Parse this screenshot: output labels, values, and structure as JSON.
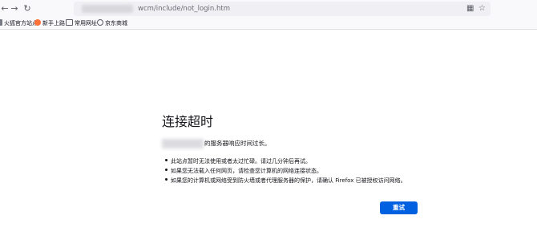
{
  "browser": {
    "url_path": "wcm/include/not_login.htm",
    "icons": {
      "back": "back-arrow-icon",
      "forward": "forward-arrow-icon",
      "reload": "reload-icon",
      "qr": "qr-code-icon",
      "bookmark": "star-icon"
    },
    "bookmarks": [
      {
        "label": "火狐官方站点"
      },
      {
        "label": "新手上路"
      },
      {
        "label": "常用网址"
      },
      {
        "label": "京东商城"
      }
    ]
  },
  "error_page": {
    "title": "连接超时",
    "description": "的服务器响应时间过长。",
    "bullets": [
      "此站点暂时无法使用或者太过忙碌。请过几分钟后再试。",
      "如果您无法载入任何网页，请检查您计算机的网络连接状态。",
      "如果您的计算机或网络受到防火墙或者代理服务器的保护，请确认 Firefox 已被授权访问网络。"
    ],
    "retry_label": "重试"
  },
  "colors": {
    "accent": "#0061e0",
    "text": "#15141a",
    "toolbar_bg": "#f9f9fb"
  }
}
